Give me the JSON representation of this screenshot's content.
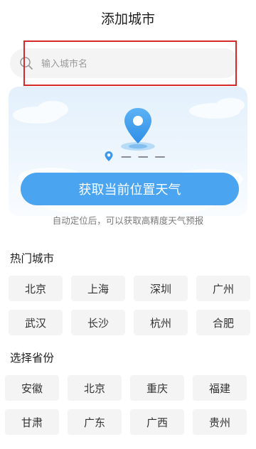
{
  "header": {
    "title": "添加城市"
  },
  "search": {
    "placeholder": "输入城市名"
  },
  "hero": {
    "location_text": "— — —"
  },
  "locate": {
    "button_label": "获取当前位置天气",
    "hint": "自动定位后，可以获取高精度天气预报"
  },
  "hot_cities": {
    "title": "热门城市",
    "items": [
      "北京",
      "上海",
      "深圳",
      "广州",
      "武汉",
      "长沙",
      "杭州",
      "合肥"
    ]
  },
  "provinces": {
    "title": "选择省份",
    "items": [
      "安徽",
      "北京",
      "重庆",
      "福建",
      "甘肃",
      "广东",
      "广西",
      "贵州"
    ]
  },
  "colors": {
    "accent": "#4aa4ef",
    "highlight": "#d42a2a",
    "chip_bg": "#f4f4f4"
  }
}
